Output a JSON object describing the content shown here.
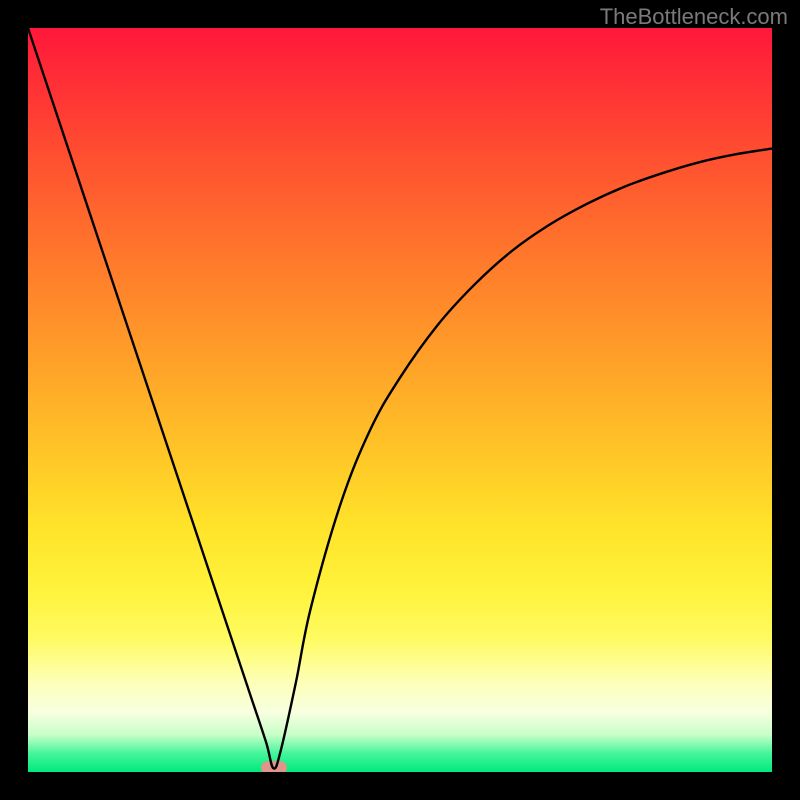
{
  "watermark": "TheBottleneck.com",
  "chart_data": {
    "type": "line",
    "title": "",
    "xlabel": "",
    "ylabel": "",
    "xlim": [
      0,
      100
    ],
    "ylim": [
      0,
      100
    ],
    "grid": false,
    "legend": false,
    "x": [
      0,
      4,
      8,
      12,
      16,
      20,
      24,
      28,
      30,
      32,
      33,
      34,
      36,
      38,
      42,
      46,
      50,
      55,
      60,
      65,
      70,
      75,
      80,
      85,
      90,
      95,
      100
    ],
    "y": [
      100,
      88,
      76,
      64,
      52,
      40,
      28,
      16,
      10,
      4,
      0.5,
      3,
      12,
      22,
      36,
      46,
      53,
      60,
      65.5,
      70,
      73.5,
      76.3,
      78.6,
      80.4,
      81.9,
      83,
      83.8
    ],
    "marker": {
      "x": 33,
      "y": 0.5
    },
    "background_gradient": {
      "direction": "vertical",
      "stops": [
        {
          "pos": 0,
          "color": "#ff173a"
        },
        {
          "pos": 50,
          "color": "#ffaa28"
        },
        {
          "pos": 75,
          "color": "#fff23a"
        },
        {
          "pos": 92,
          "color": "#f7ffe0"
        },
        {
          "pos": 100,
          "color": "#00e97e"
        }
      ]
    }
  }
}
